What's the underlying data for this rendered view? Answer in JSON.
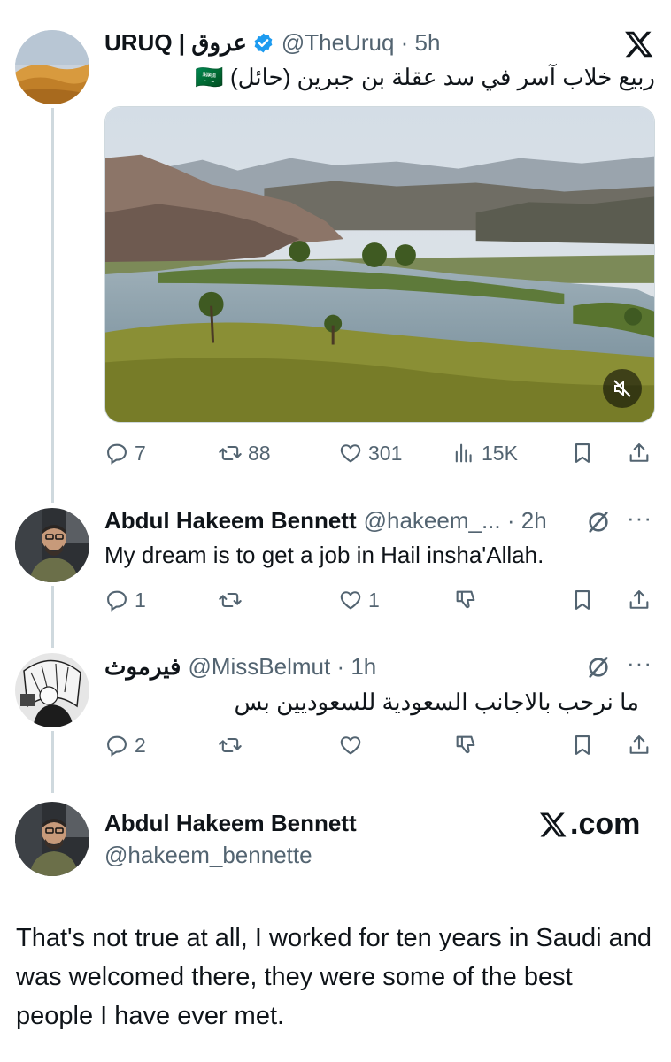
{
  "tweet": {
    "display_name": "URUQ | عروق",
    "handle_time": "@TheUruq · 5h",
    "text": "ربيع خلاب آسر في سد عقلة بن جبرين (حائل) 🇸🇦",
    "stats": {
      "replies": "7",
      "reposts": "88",
      "likes": "301",
      "views": "15K"
    }
  },
  "reply1": {
    "display_name": "Abdul Hakeem Bennett",
    "handle_time": "@hakeem_... · 2h",
    "text": "My dream is to get a job in Hail insha'Allah.",
    "stats": {
      "replies": "1",
      "reposts": "",
      "likes": "1"
    }
  },
  "reply2": {
    "display_name": "فيرموث",
    "handle_time": "@MissBelmut · 1h",
    "text": "ما نرحب بالاجانب السعودية للسعوديين بس",
    "stats": {
      "replies": "2",
      "reposts": "",
      "likes": ""
    }
  },
  "response": {
    "display_name": "Abdul Hakeem Bennett",
    "handle": "@hakeem_bennette",
    "brand": ".com",
    "text": "That's not true at all, I worked for ten years in Saudi and was welcomed there, they were some of the best people I have ever met."
  },
  "colors": {
    "text": "#0f1419",
    "muted": "#536471",
    "verified": "#1d9bf0",
    "line": "#cfd9de"
  },
  "icons": [
    "x-logo-icon",
    "verified-badge-icon",
    "reply-icon",
    "repost-icon",
    "like-icon",
    "views-icon",
    "bookmark-icon",
    "share-icon",
    "grok-icon",
    "more-icon",
    "muted-icon",
    "dislike-icon"
  ]
}
